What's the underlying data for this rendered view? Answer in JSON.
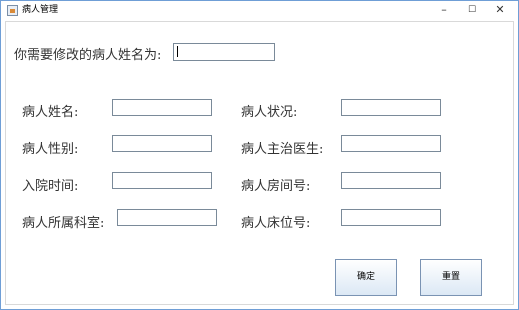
{
  "window": {
    "title": "病人管理",
    "minimize": "–",
    "maximize": "☐",
    "close": "✕"
  },
  "search": {
    "label": "你需要修改的病人姓名为:",
    "value": ""
  },
  "form": {
    "name_label": "病人姓名:",
    "status_label": "病人状况:",
    "gender_label": "病人性别:",
    "doctor_label": "病人主治医生:",
    "admit_time_label": "入院时间:",
    "room_label": "病人房间号:",
    "dept_label": "病人所属科室:",
    "bed_label": "病人床位号:"
  },
  "buttons": {
    "confirm": "确定",
    "reset": "重置"
  }
}
